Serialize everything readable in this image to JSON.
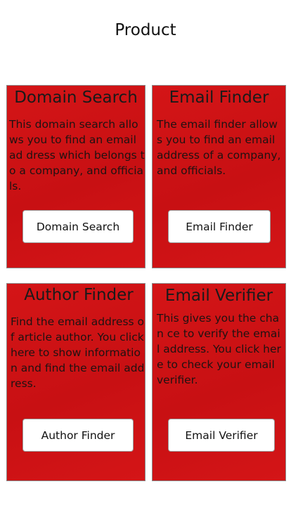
{
  "page": {
    "title": "Product"
  },
  "colors": {
    "card_red": "#d41517",
    "card_red_dark": "#c81013",
    "button_bg": "#ffffff",
    "border": "#8a8a8a"
  },
  "cards": [
    {
      "title": "Domain Search",
      "description": "This domain search allows you to find an email ad dress which belongs to a company, and officials.",
      "button_label": "Domain Search"
    },
    {
      "title": "Email Finder",
      "description": "The email finder allows you to find an email address of a company, and officials.",
      "button_label": "Email Finder"
    },
    {
      "title": "Author Finder",
      "description": "Find the email address of article author. You click here to show information and find the email address.",
      "button_label": "Author Finder"
    },
    {
      "title": "Email Verifier",
      "description": "This gives you the chan ce to verify the email address. You click here to check your email verifier.",
      "button_label": "Email Verifier"
    }
  ]
}
